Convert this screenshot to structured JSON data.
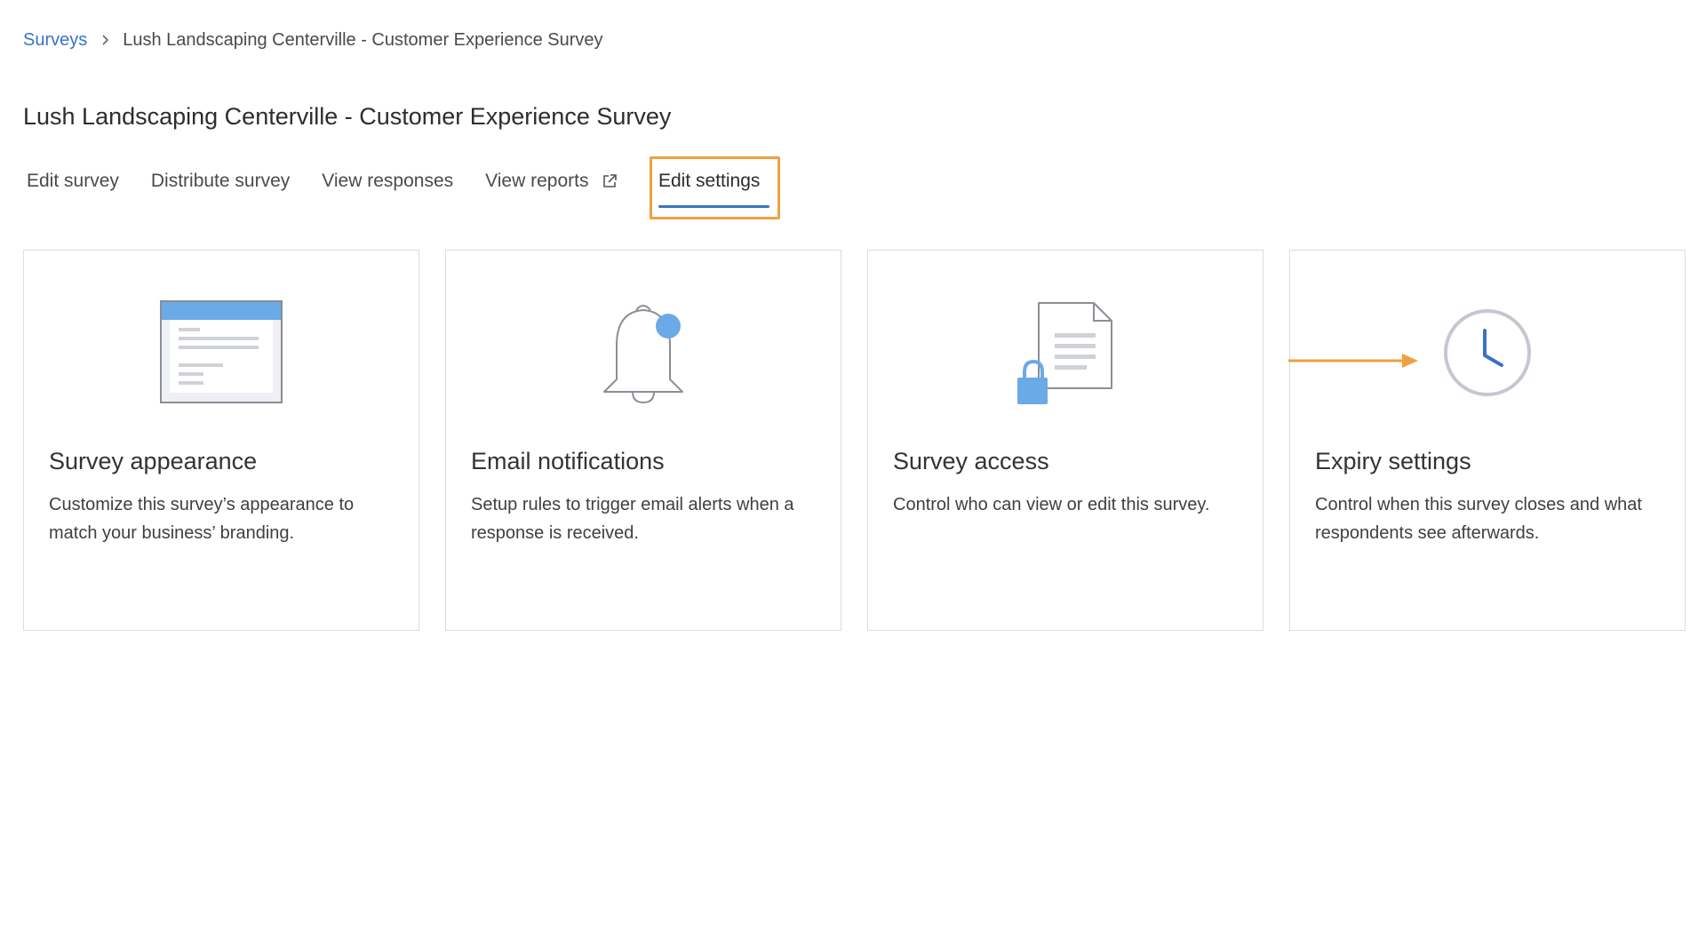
{
  "breadcrumb": {
    "root": "Surveys",
    "current": "Lush Landscaping Centerville - Customer Experience Survey"
  },
  "page_title": "Lush Landscaping Centerville - Customer Experience Survey",
  "tabs": [
    {
      "label": "Edit survey"
    },
    {
      "label": "Distribute survey"
    },
    {
      "label": "View responses"
    },
    {
      "label": "View reports",
      "icon": "external-link-icon"
    },
    {
      "label": "Edit settings",
      "active": true
    }
  ],
  "cards": [
    {
      "title": "Survey appearance",
      "description": "Customize this survey’s appearance to match your business’ branding.",
      "icon": "browser-window-icon"
    },
    {
      "title": "Email notifications",
      "description": "Setup rules to trigger email alerts when a response is received.",
      "icon": "bell-notification-icon"
    },
    {
      "title": "Survey access",
      "description": "Control who can view or edit this survey.",
      "icon": "locked-document-icon"
    },
    {
      "title": "Expiry settings",
      "description": "Control when this survey closes and what respondents see afterwards.",
      "icon": "clock-icon"
    }
  ],
  "colors": {
    "accent": "#3a72c4",
    "highlight": "#f0a040",
    "icon_blue": "#6aaae6",
    "icon_gray": "#8a8e96"
  }
}
